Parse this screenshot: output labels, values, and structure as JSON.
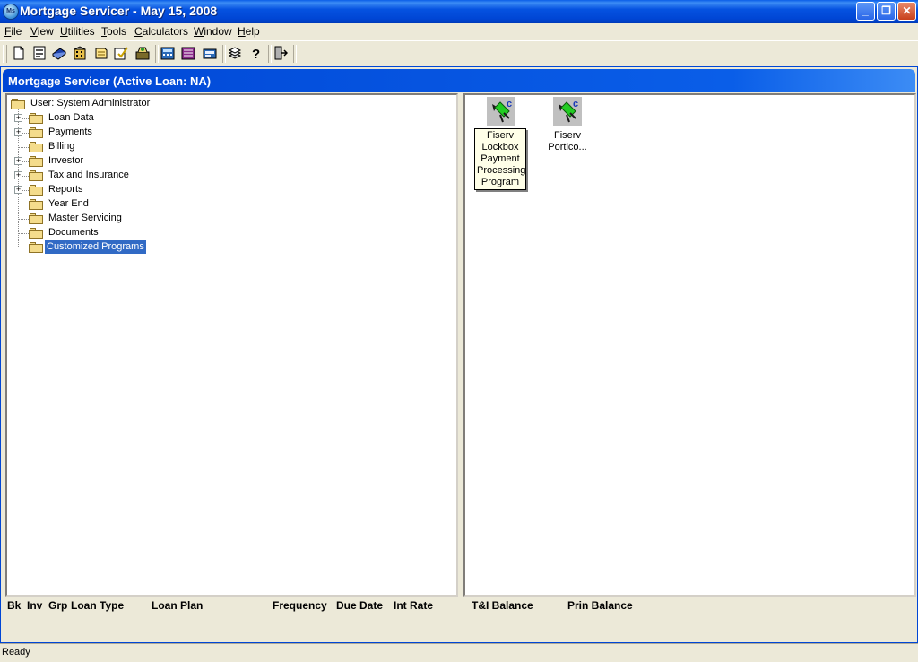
{
  "window": {
    "title": "Mortgage Servicer  -  May 15, 2008",
    "app_icon_text": "Ms",
    "minimize_glyph": "_",
    "maximize_glyph": "❐",
    "close_glyph": "✕"
  },
  "menu": {
    "file": {
      "u": "F",
      "rest": "ile"
    },
    "view": {
      "u": "V",
      "rest": "iew"
    },
    "utilities": {
      "u": "U",
      "rest": "tilities"
    },
    "tools": {
      "u": "T",
      "rest": "ools"
    },
    "calculators": {
      "u": "C",
      "rest": "alculators"
    },
    "window": {
      "u": "W",
      "rest": "indow"
    },
    "help": {
      "u": "H",
      "rest": "elp"
    }
  },
  "toolbar": {
    "icons": [
      "new-document-icon",
      "form-icon",
      "book-icon",
      "building-icon",
      "notes-icon",
      "edit-check-icon",
      "archive-icon",
      "calculator-icon",
      "ledger-icon",
      "report-icon",
      "stack-icon",
      "help-icon",
      "exit-icon"
    ]
  },
  "child_window": {
    "title": "Mortgage Servicer (Active Loan: NA)"
  },
  "tree": {
    "root": "User: System Administrator",
    "items": [
      {
        "label": "Loan Data",
        "expandable": true
      },
      {
        "label": "Payments",
        "expandable": true
      },
      {
        "label": "Billing",
        "expandable": false
      },
      {
        "label": "Investor",
        "expandable": true
      },
      {
        "label": "Tax and Insurance",
        "expandable": true
      },
      {
        "label": "Reports",
        "expandable": true
      },
      {
        "label": "Year End",
        "expandable": false
      },
      {
        "label": "Master Servicing",
        "expandable": false
      },
      {
        "label": "Documents",
        "expandable": false
      },
      {
        "label": "Customized Programs",
        "expandable": false,
        "selected": true
      }
    ]
  },
  "programs": [
    {
      "line1": "Fiserv",
      "line2": "Lockbox",
      "line3": "Payment",
      "line4": "Processing",
      "line5": "Program"
    },
    {
      "line1": "Fiserv",
      "line2": "Portico..."
    }
  ],
  "columns": {
    "bk": "Bk",
    "inv": "Inv",
    "grp": "Grp",
    "loan_type": "Loan Type",
    "loan_plan": "Loan Plan",
    "frequency": "Frequency",
    "due_date": "Due Date",
    "int_rate": "Int Rate",
    "ti_balance": "T&I Balance",
    "prin_balance": "Prin Balance"
  },
  "status": {
    "text": "Ready"
  },
  "colors": {
    "title_blue": "#0046d5",
    "selection": "#316ac5",
    "face": "#ece9d8"
  }
}
